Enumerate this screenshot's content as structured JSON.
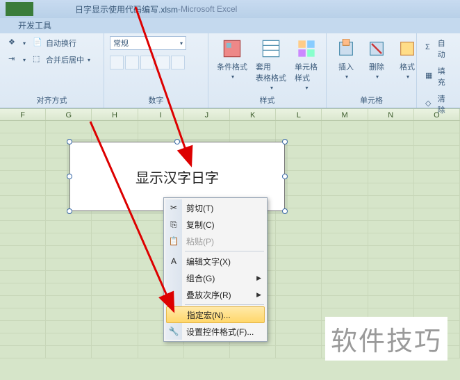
{
  "titlebar": {
    "filename": "日字显示使用代码编写.xlsm",
    "sep": " - ",
    "app": "Microsoft Excel"
  },
  "tabs": {
    "dev": "开发工具"
  },
  "ribbon": {
    "alignment": {
      "label": "对齐方式",
      "wrap": "自动换行",
      "merge": "合并后居中"
    },
    "number": {
      "label": "数字",
      "format": "常规"
    },
    "styles": {
      "label": "样式",
      "cond": "条件格式",
      "table": "套用\n表格格式",
      "cell": "单元格\n样式"
    },
    "cells": {
      "label": "单元格",
      "insert": "插入",
      "delete": "删除",
      "format": "格式"
    },
    "editing": {
      "autosum": "自动",
      "fill": "填充",
      "clear": "清除"
    }
  },
  "columns": [
    "F",
    "G",
    "H",
    "I",
    "J",
    "K",
    "L",
    "M",
    "N",
    "O"
  ],
  "textbox": {
    "text": "显示汉字日字"
  },
  "context_menu": {
    "cut": "剪切(T)",
    "copy": "复制(C)",
    "paste": "粘贴(P)",
    "edit_text": "编辑文字(X)",
    "group": "组合(G)",
    "order": "叠放次序(R)",
    "assign_macro": "指定宏(N)...",
    "format_control": "设置控件格式(F)..."
  },
  "watermark": "软件技巧"
}
